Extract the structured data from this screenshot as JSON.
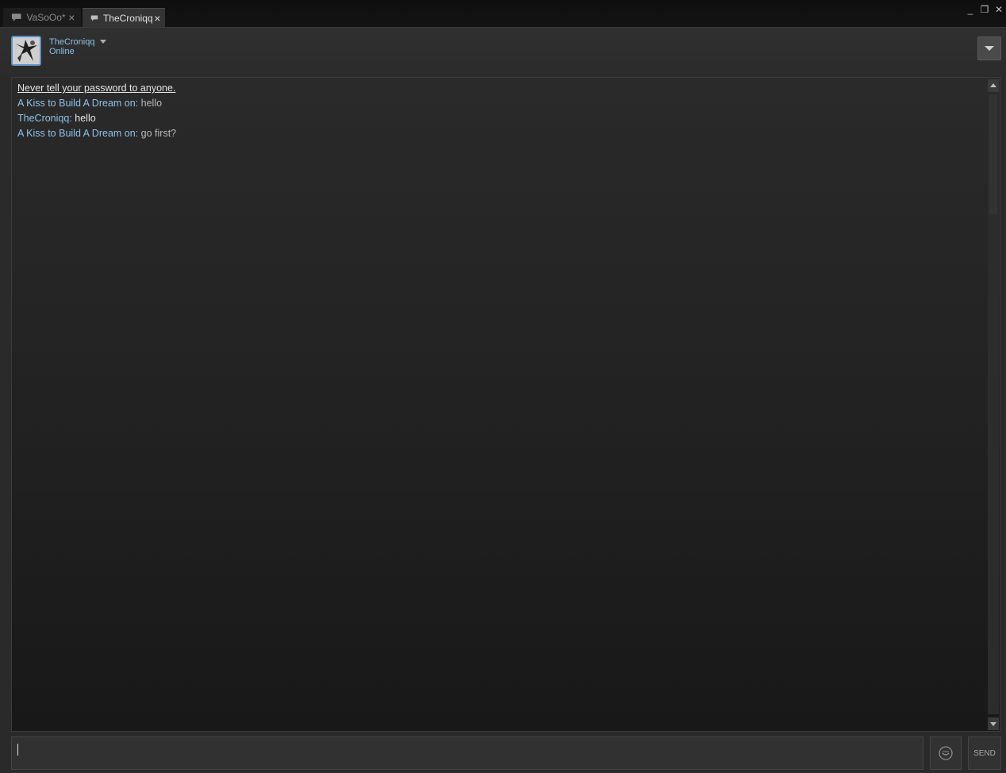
{
  "tabs": [
    {
      "label": "VaSoOo*",
      "close": "×",
      "icon": "chat-bubble-icon"
    },
    {
      "label": "TheCroniqq",
      "close": "×",
      "icon": "chat-bubble-icon"
    }
  ],
  "window_controls": {
    "minimize": "_",
    "restore": "❐",
    "close": "✕"
  },
  "header": {
    "friend_name": "TheCroniqq",
    "status": "Online",
    "status_color": "#8fc1e8",
    "avatar_border_color": "#5d8fc2"
  },
  "chat": {
    "warning": "Never tell your password to anyone.",
    "messages": [
      {
        "sender": "A Kiss to Build A Dream on",
        "sep": ": ",
        "text": "hello"
      },
      {
        "sender": "TheCroniqq",
        "sep": ": ",
        "text": "hello"
      },
      {
        "sender": "A Kiss to Build A Dream on",
        "sep": ": ",
        "text": "go first?"
      }
    ]
  },
  "input": {
    "value": ""
  },
  "send_label": "SEND"
}
